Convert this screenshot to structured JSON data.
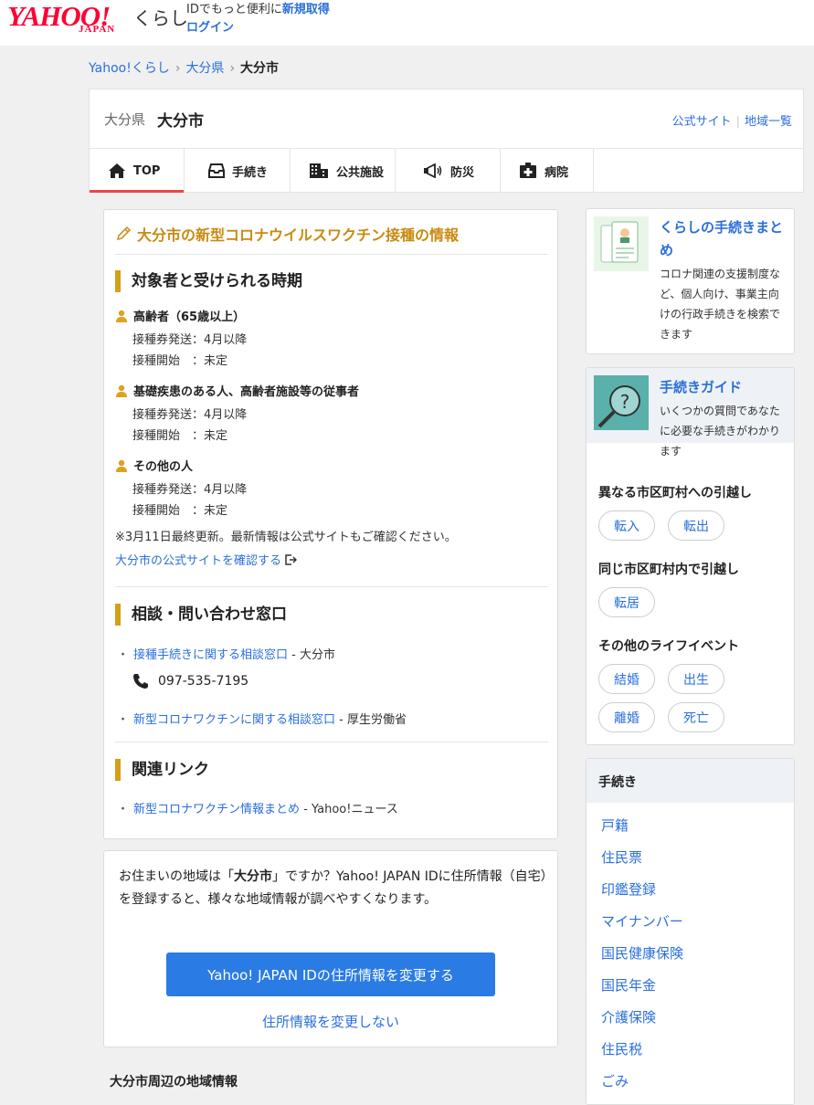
{
  "header": {
    "logo_text": "YAHOO!",
    "logo_sub": "JAPAN",
    "service_name": "くらし",
    "promo_text": "IDでもっと便利に",
    "signup_label": "新規取得",
    "login_label": "ログイン"
  },
  "breadcrumb": [
    "Yahoo!くらし",
    "大分県",
    "大分市"
  ],
  "region": {
    "prefecture": "大分県",
    "city": "大分市",
    "links": [
      "公式サイト",
      "地域一覧"
    ]
  },
  "tabs": [
    {
      "label": "TOP",
      "icon": "home-icon",
      "active": true
    },
    {
      "label": "手続き",
      "icon": "inbox-icon"
    },
    {
      "label": "公共施設",
      "icon": "building-icon"
    },
    {
      "label": "防災",
      "icon": "megaphone-icon"
    },
    {
      "label": "病院",
      "icon": "hospital-icon"
    }
  ],
  "vaccine": {
    "title": "大分市の新型コロナウイルスワクチン接種の情報",
    "section1_title": "対象者と受けられる時期",
    "groups": [
      {
        "name": "高齢者（65歳以上）",
        "ticket": "接種券発送：4月以降",
        "start": "接種開始　：未定"
      },
      {
        "name": "基礎疾患のある人、高齢者施設等の従事者",
        "ticket": "接種券発送：4月以降",
        "start": "接種開始　：未定"
      },
      {
        "name": "その他の人",
        "ticket": "接種券発送：4月以降",
        "start": "接種開始　：未定"
      }
    ],
    "update_note": "※3月11日最終更新。最新情報は公式サイトもご確認ください。",
    "official_link": "大分市の公式サイトを確認する",
    "section2_title": "相談・問い合わせ窓口",
    "contacts": [
      {
        "link": "接種手続きに関する相談窓口",
        "org": " - 大分市"
      },
      {
        "link": "新型コロナワクチンに関する相談窓口",
        "org": " - 厚生労働省"
      }
    ],
    "phone": "097-535-7195",
    "section3_title": "関連リンク",
    "related": [
      {
        "link": "新型コロナワクチン情報まとめ",
        "org": " - Yahoo!ニュース"
      }
    ]
  },
  "address": {
    "text_pre": "お住まいの地域は「",
    "text_city": "大分市",
    "text_post": "」ですか？Yahoo! JAPAN IDに住所情報（自宅）を登録すると、様々な地域情報が調べやすくなります。",
    "change_button": "Yahoo! JAPAN IDの住所情報を変更する",
    "skip_link": "住所情報を変更しない"
  },
  "nearby_title": "大分市周辺の地域情報",
  "promo": {
    "title": "くらしの手続きまとめ",
    "description": "コロナ関連の支援制度など、個人向け、事業主向けの行政手続きを検索できます"
  },
  "guide": {
    "title": "手続きガイド",
    "description": "いくつかの質問であなたに必要な手続きがわかります",
    "groups": [
      {
        "label": "異なる市区町村への引越し",
        "buttons": [
          "転入",
          "転出"
        ]
      },
      {
        "label": "同じ市区町村内で引越し",
        "buttons": [
          "転居"
        ]
      },
      {
        "label": "その他のライフイベント",
        "buttons": [
          "結婚",
          "出生",
          "離婚",
          "死亡"
        ]
      }
    ]
  },
  "procedures": {
    "title": "手続き",
    "items": [
      "戸籍",
      "住民票",
      "印鑑登録",
      "マイナンバー",
      "国民健康保険",
      "国民年金",
      "介護保険",
      "住民税",
      "ごみ"
    ]
  },
  "colors": {
    "accent_blue": "#2a7be4",
    "link": "#2a6fdb",
    "section_bar": "#d4a017",
    "title_orange": "#c98a10",
    "active_tab": "#ee4444",
    "logo_red": "#ff0033"
  }
}
